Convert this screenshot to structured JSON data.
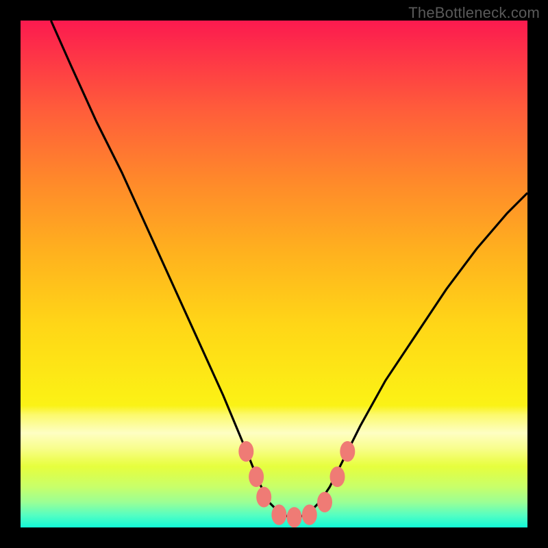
{
  "watermark": {
    "text": "TheBottleneck.com"
  },
  "colors": {
    "frame": "#000000",
    "curve_stroke": "#000000",
    "marker_fill": "#ef7b75",
    "marker_stroke": "#ef7b75",
    "gradient_stops": [
      "#fc1a4f",
      "#ff5e3a",
      "#ff8a2a",
      "#ffb21e",
      "#ffd617",
      "#fcef15",
      "#f6fb1b",
      "#e6fe3e",
      "#9bff95",
      "#12f9d7"
    ]
  },
  "chart_data": {
    "type": "line",
    "title": "",
    "xlabel": "",
    "ylabel": "",
    "xlim": [
      0,
      100
    ],
    "ylim": [
      0,
      100
    ],
    "grid": false,
    "legend": false,
    "series": [
      {
        "name": "curve",
        "x": [
          6,
          10,
          15,
          20,
          25,
          30,
          35,
          40,
          45,
          47,
          49,
          51,
          53,
          55,
          57,
          59,
          61,
          63,
          67,
          72,
          78,
          84,
          90,
          96,
          100
        ],
        "y": [
          100,
          91,
          80,
          70,
          59,
          48,
          37,
          26,
          14,
          9,
          5,
          3,
          2,
          2,
          3,
          5,
          8,
          12,
          20,
          29,
          38,
          47,
          55,
          62,
          66
        ]
      }
    ],
    "markers": [
      {
        "x": 44.5,
        "y": 15
      },
      {
        "x": 46.5,
        "y": 10
      },
      {
        "x": 48.0,
        "y": 6
      },
      {
        "x": 51.0,
        "y": 2.5
      },
      {
        "x": 54.0,
        "y": 2
      },
      {
        "x": 57.0,
        "y": 2.5
      },
      {
        "x": 60.0,
        "y": 5
      },
      {
        "x": 62.5,
        "y": 10
      },
      {
        "x": 64.5,
        "y": 15
      }
    ]
  }
}
